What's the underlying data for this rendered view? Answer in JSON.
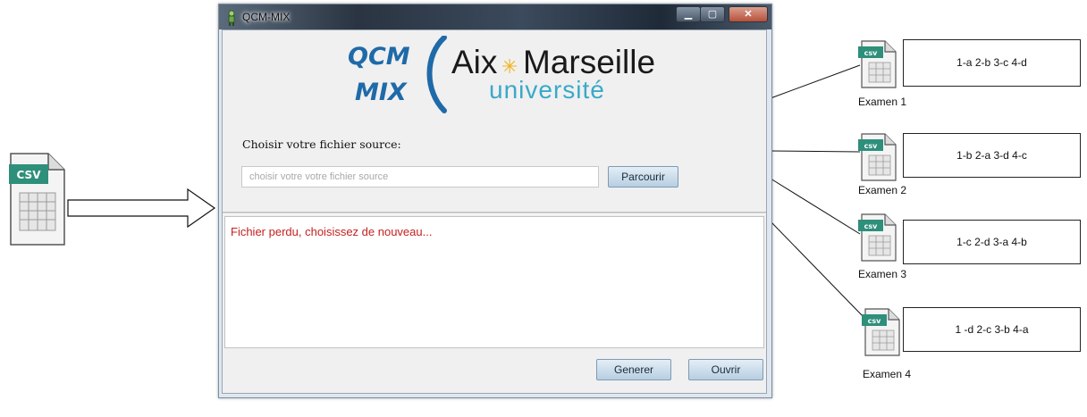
{
  "window": {
    "title": "QCM-MIX",
    "controls": {
      "minimize": "▁",
      "maximize": "▢",
      "close": "✕"
    }
  },
  "logo": {
    "left_line1": "QCM",
    "left_line2": "MIX",
    "brand_word1": "Aix",
    "brand_star": "✳",
    "brand_word2": "Marseille",
    "brand_sub": "université"
  },
  "form": {
    "label": "Choisir votre fichier source:",
    "input_value": "",
    "input_placeholder": "choisir votre votre fichier source",
    "browse_label": "Parcourir"
  },
  "log": {
    "message": "Fichier perdu, choisissez de nouveau..."
  },
  "actions": {
    "generate_label": "Generer",
    "open_label": "Ouvrir"
  },
  "source_file": {
    "badge": "CSV",
    "icon": "csv-file-icon"
  },
  "exams": [
    {
      "label": "Examen 1",
      "badge": "csv",
      "answers": "1-a 2-b 3-c 4-d"
    },
    {
      "label": "Examen 2",
      "badge": "csv",
      "answers": "1-b  2-a  3-d  4-c"
    },
    {
      "label": "Examen 3",
      "badge": "csv",
      "answers": "1-c  2-d  3-a  4-b"
    },
    {
      "label": "Examen 4",
      "badge": "csv",
      "answers": "1 -d  2-c  3-b  4-a"
    }
  ],
  "colors": {
    "logo_blue": "#1f6aa8",
    "logo_dark": "#1a1a1a",
    "logo_star": "#f2b21c",
    "logo_teal": "#3aa9c8",
    "csv_badge": "#2e8f7a",
    "error_text": "#c62020"
  }
}
